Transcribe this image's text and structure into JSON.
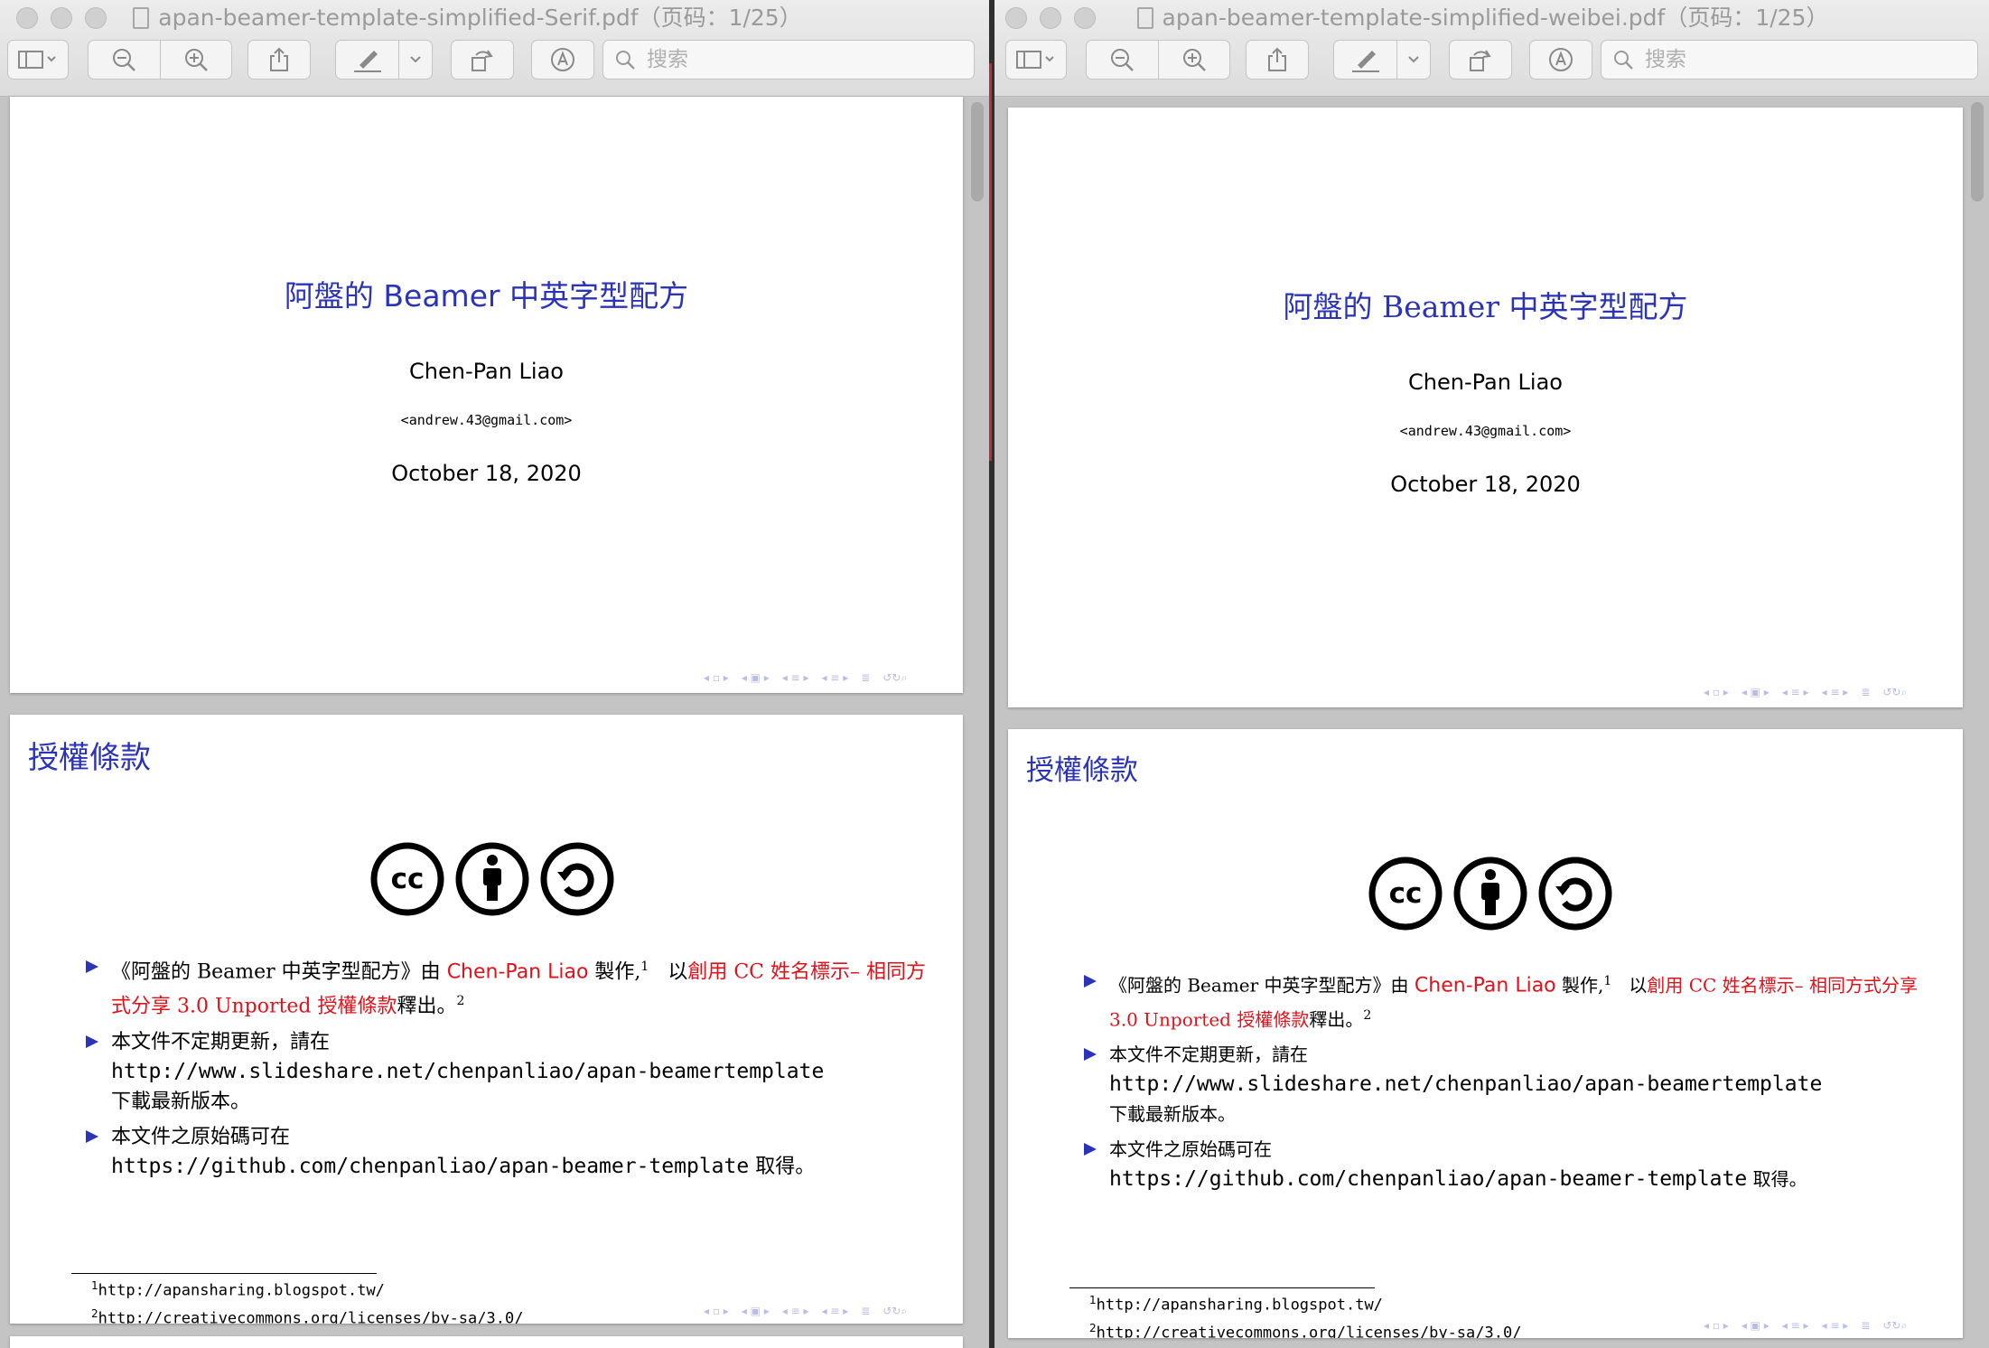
{
  "windows": [
    {
      "title": "apan-beamer-template-simplified-Serif.pdf（页码：1/25）",
      "search_placeholder": "搜索",
      "slide1": {
        "title": "阿盤的 Beamer 中英字型配方",
        "author": "Chen-Pan Liao",
        "email": "<andrew.43@gmail.com>",
        "date": "October 18, 2020"
      },
      "slide2": {
        "frametitle": "授權條款",
        "item1": {
          "p1": "《阿盤的 Beamer 中英字型配方》由",
          "author": "Chen-Pan Liao",
          "p2": "製作,",
          "sup1": "1",
          "p3": "以",
          "license": "創用 CC 姓名標示– 相同方式分享 3.0 Unported 授權條款",
          "p4": "釋出。",
          "sup2": "2"
        },
        "item2": {
          "p1": "本文件不定期更新，請在",
          "url": "http://www.slideshare.net/chenpanliao/apan-beamertemplate",
          "p2": "下載最新版本。"
        },
        "item3": {
          "p1": "本文件之原始碼可在",
          "url": "https://github.com/chenpanliao/apan-beamer-template",
          "p2": "取得。"
        },
        "footnotes": [
          {
            "mark": "1",
            "text": "http://apansharing.blogspot.tw/"
          },
          {
            "mark": "2",
            "text": "http://creativecommons.org/licenses/by-sa/3.0/"
          }
        ]
      }
    },
    {
      "title": "apan-beamer-template-simplified-weibei.pdf（页码：1/25）",
      "search_placeholder": "搜索",
      "slide1": {
        "title": "阿盤的 Beamer 中英字型配方",
        "author": "Chen-Pan Liao",
        "email": "<andrew.43@gmail.com>",
        "date": "October 18, 2020"
      },
      "slide2": {
        "frametitle": "授權條款",
        "item1": {
          "p1": "《阿盤的 Beamer 中英字型配方》由",
          "author": "Chen-Pan Liao",
          "p2": "製作,",
          "sup1": "1",
          "p3": "以",
          "license": "創用 CC 姓名標示– 相同方式分享 3.0 Unported 授權條款",
          "p4": "釋出。",
          "sup2": "2"
        },
        "item2": {
          "p1": "本文件不定期更新，請在",
          "url": "http://www.slideshare.net/chenpanliao/apan-beamertemplate",
          "p2": "下載最新版本。"
        },
        "item3": {
          "p1": "本文件之原始碼可在",
          "url": "https://github.com/chenpanliao/apan-beamer-template",
          "p2": "取得。"
        },
        "footnotes": [
          {
            "mark": "1",
            "text": "http://apansharing.blogspot.tw/"
          },
          {
            "mark": "2",
            "text": "http://creativecommons.org/licenses/by-sa/3.0/"
          }
        ]
      }
    }
  ],
  "colors": {
    "beamer_blue": "#2b34b8",
    "link_red": "#e3101a",
    "nav_light": "#b8bde8"
  },
  "icons": [
    "sidebar-icon",
    "zoom-out-icon",
    "zoom-in-icon",
    "share-icon",
    "markup-pen-icon",
    "rotate-icon",
    "annotate-icon",
    "search-icon",
    "cc-icon",
    "by-icon",
    "sa-icon"
  ]
}
